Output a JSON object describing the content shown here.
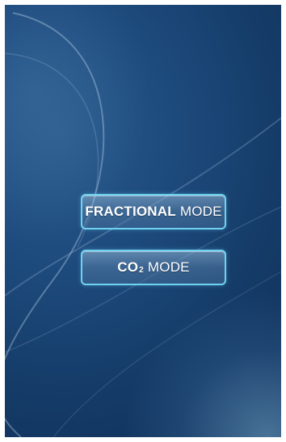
{
  "screen": {
    "background_color": "#1d4a7c",
    "accent_border_color": "#6fd2f0"
  },
  "buttons": {
    "fractional": {
      "bold_text": "FRACTIONAL",
      "light_text": "MODE"
    },
    "co2": {
      "bold_text": "CO",
      "subscript_text": "2",
      "light_text": "MODE"
    }
  }
}
